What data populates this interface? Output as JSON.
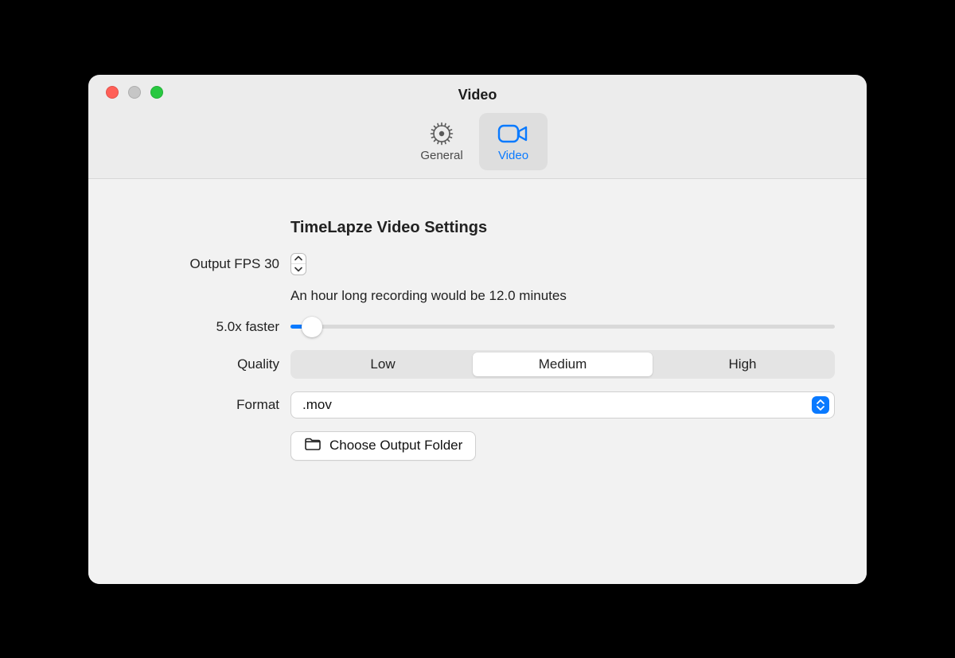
{
  "window_title": "Video",
  "tabs": {
    "general": "General",
    "video": "Video"
  },
  "section_title": "TimeLapze Video Settings",
  "output_fps": {
    "label": "Output FPS 30"
  },
  "duration_hint": "An hour long recording would be 12.0 minutes",
  "speed": {
    "label": "5.0x faster",
    "slider_percent": 4
  },
  "quality": {
    "label": "Quality",
    "options": {
      "low": "Low",
      "medium": "Medium",
      "high": "High"
    },
    "selected": "medium"
  },
  "format": {
    "label": "Format",
    "value": ".mov"
  },
  "output_folder_button": "Choose Output Folder"
}
